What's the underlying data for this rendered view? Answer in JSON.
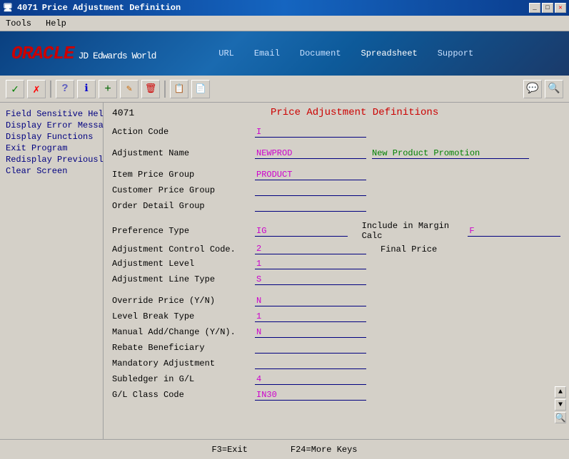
{
  "titlebar": {
    "icon": "4071",
    "title": "Price Adjustment Definition"
  },
  "menubar": {
    "items": [
      "Tools",
      "Help"
    ]
  },
  "header": {
    "logo": "ORACLE",
    "logo_sub": "JD Edwards World",
    "nav": [
      "URL",
      "Email",
      "Document",
      "Spreadsheet",
      "Support"
    ]
  },
  "toolbar": {
    "buttons": [
      "✓",
      "✗",
      "?",
      "ℹ",
      "+",
      "✎",
      "🗑",
      "📋",
      "📄"
    ]
  },
  "sidebar": {
    "items": [
      "Field Sensitive Help",
      "Display Error Message",
      "Display Functions",
      "Exit Program",
      "Redisplay Previously U",
      "Clear Screen"
    ]
  },
  "form": {
    "id": "4071",
    "title": "Price Adjustment Definitions",
    "fields": {
      "action_code": {
        "label": "Action Code",
        "value": "I"
      },
      "adjustment_name": {
        "label": "Adjustment Name",
        "value": "NEWPROD",
        "text": "New Product Promotion"
      },
      "item_price_group": {
        "label": "Item Price Group",
        "value": "PRODUCT"
      },
      "customer_price_group": {
        "label": "Customer Price Group",
        "value": ""
      },
      "order_detail_group": {
        "label": "Order Detail Group",
        "value": ""
      },
      "preference_type": {
        "label": "Preference Type",
        "value": "IG"
      },
      "include_margin": {
        "label": "Include in Margin Calc",
        "value": "F"
      },
      "adj_control_code": {
        "label": "Adjustment Control Code.",
        "value": "2"
      },
      "final_price": {
        "label": "Final Price",
        "value": ""
      },
      "adj_level": {
        "label": "Adjustment Level",
        "value": "1"
      },
      "adj_line_type": {
        "label": "Adjustment Line Type",
        "value": "S"
      },
      "override_price": {
        "label": "Override Price (Y/N)",
        "value": "N"
      },
      "level_break": {
        "label": "Level Break Type",
        "value": "1"
      },
      "manual_add": {
        "label": "Manual Add/Change (Y/N).",
        "value": "N"
      },
      "rebate_beneficiary": {
        "label": "Rebate Beneficiary",
        "value": ""
      },
      "mandatory_adjustment": {
        "label": "Mandatory Adjustment",
        "value": ""
      },
      "subledger": {
        "label": "Subledger in G/L",
        "value": "4"
      },
      "gl_class": {
        "label": "G/L Class Code",
        "value": "IN30"
      }
    }
  },
  "statusbar": {
    "keys": [
      "F3=Exit",
      "F24=More Keys"
    ]
  }
}
